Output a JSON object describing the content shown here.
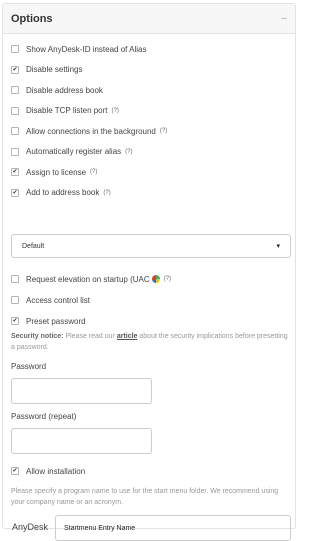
{
  "header": {
    "title": "Options",
    "collapse_label": "–"
  },
  "options": [
    {
      "label": "Show AnyDesk-ID instead of Alias",
      "checked": false,
      "help": ""
    },
    {
      "label": "Disable settings",
      "checked": true,
      "help": ""
    },
    {
      "label": "Disable address book",
      "checked": false,
      "help": ""
    },
    {
      "label": "Disable TCP listen port",
      "checked": false,
      "help": "(?)"
    },
    {
      "label": "Allow connections in the background",
      "checked": false,
      "help": "(?)"
    },
    {
      "label": "Automatically register alias",
      "checked": false,
      "help": "(?)"
    },
    {
      "label": "Assign to license",
      "checked": true,
      "help": "(?)"
    },
    {
      "label": "Add to address book",
      "checked": true,
      "help": "(?)"
    }
  ],
  "addressbook_select": {
    "value": "Default",
    "arrow": "▾"
  },
  "options2": [
    {
      "label": "Request elevation on startup (UAC",
      "checked": false,
      "help": "(?)",
      "icon": "uac-shield-icon"
    },
    {
      "label": "Access control list",
      "checked": false,
      "help": ""
    },
    {
      "label": "Preset password",
      "checked": true,
      "help": ""
    }
  ],
  "security_notice": {
    "prefix": "Security notice:",
    "text_before": " Please read our ",
    "link": "article",
    "text_after": " about the security implications before presetting a password."
  },
  "password": {
    "label": "Password",
    "value": ""
  },
  "password_repeat": {
    "label": "Password (repeat)",
    "value": ""
  },
  "allow_installation": {
    "label": "Allow installation",
    "checked": true
  },
  "start_menu_note": "Please specify a program name to use for the start menu folder. We recommend using your company name or an acronym.",
  "start_menu": {
    "prefix": "AnyDesk",
    "value": "Startmenu Entry Name"
  },
  "checkmark": "✔"
}
